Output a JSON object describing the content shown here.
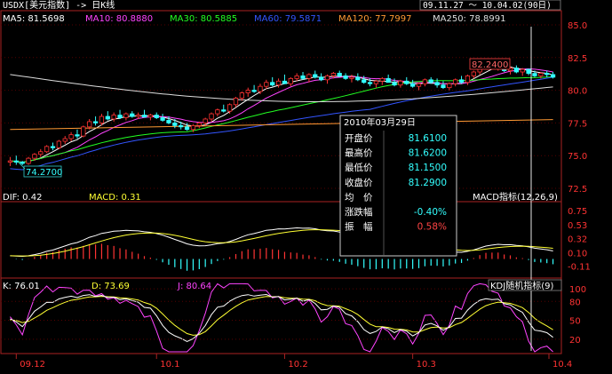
{
  "header": {
    "symbol": "USDX[美元指数] -> 日K线",
    "range": "09.11.27 ～ 10.04.02(90日)"
  },
  "ma_legend": [
    {
      "label": "MA5: 81.5698",
      "color": "#ffffff"
    },
    {
      "label": "MA10: 80.8880",
      "color": "#ff44ff"
    },
    {
      "label": "MA30: 80.5885",
      "color": "#22ff22"
    },
    {
      "label": "MA60: 79.5871",
      "color": "#3355ff"
    },
    {
      "label": "MA120: 77.7997",
      "color": "#ff9933"
    },
    {
      "label": "MA250: 78.8991",
      "color": "#dddddd"
    }
  ],
  "price_axis": [
    "85.0",
    "82.5",
    "80.0",
    "77.5",
    "75.0",
    "72.5"
  ],
  "price_high_label": "82.2400",
  "price_low_label": "74.2700",
  "macd_panel": {
    "dif_label": "DIF: 0.42",
    "macd_label": "MACD: 0.31",
    "name": "MACD指标(12,26,9)",
    "axis": [
      "0.75",
      "0.53",
      "0.32",
      "0.10",
      "-0.11"
    ]
  },
  "kdj_panel": {
    "k_label": "K: 76.01",
    "d_label": "D: 73.69",
    "j_label": "J: 80.64",
    "name": "KDJ随机指标(9)",
    "axis": [
      "100",
      "80",
      "50",
      "20"
    ]
  },
  "date_axis": [
    "09.12",
    "10.1",
    "10.2",
    "10.3",
    "10.4"
  ],
  "tooltip": {
    "date": "2010年03月29日",
    "rows": [
      {
        "label": "开盘价",
        "value": "81.6100"
      },
      {
        "label": "最高价",
        "value": "81.6200"
      },
      {
        "label": "最低价",
        "value": "81.1500"
      },
      {
        "label": "收盘价",
        "value": "81.2900"
      },
      {
        "label": "均　价",
        "value": ""
      },
      {
        "label": "涨跌幅",
        "value": "-0.40%"
      },
      {
        "label": "振　幅",
        "value": "0.58%"
      }
    ]
  },
  "colors": {
    "up": "#ff3333",
    "down": "#33ffff",
    "frame": "#aa2222",
    "axis_text": "#ff3333"
  },
  "chart_data": [
    {
      "type": "candlestick",
      "ylim": [
        72.5,
        85.0
      ],
      "candles": [
        [
          74.5,
          74.9,
          74.2,
          74.6
        ],
        [
          74.6,
          75.0,
          74.3,
          74.5
        ],
        [
          74.5,
          74.6,
          74.27,
          74.4
        ],
        [
          74.4,
          74.9,
          74.3,
          74.8
        ],
        [
          74.8,
          75.2,
          74.6,
          75.1
        ],
        [
          75.1,
          75.5,
          74.9,
          75.3
        ],
        [
          75.3,
          75.8,
          75.2,
          75.7
        ],
        [
          75.7,
          76.0,
          75.4,
          75.6
        ],
        [
          75.6,
          76.2,
          75.5,
          76.1
        ],
        [
          76.1,
          76.5,
          75.9,
          76.3
        ],
        [
          76.3,
          76.8,
          76.1,
          76.6
        ],
        [
          76.6,
          77.0,
          76.3,
          76.5
        ],
        [
          76.5,
          77.3,
          76.4,
          77.2
        ],
        [
          77.2,
          77.8,
          77.0,
          77.6
        ],
        [
          77.6,
          78.0,
          77.3,
          77.5
        ],
        [
          77.5,
          78.2,
          77.3,
          78.0
        ],
        [
          78.0,
          78.4,
          77.7,
          77.8
        ],
        [
          77.8,
          78.3,
          77.6,
          78.1
        ],
        [
          78.1,
          78.5,
          77.8,
          77.9
        ],
        [
          77.9,
          78.3,
          77.7,
          78.2
        ],
        [
          78.2,
          78.4,
          77.9,
          78.0
        ],
        [
          78.0,
          78.3,
          77.8,
          78.1
        ],
        [
          78.1,
          78.5,
          77.9,
          77.95
        ],
        [
          77.95,
          78.2,
          77.7,
          78.1
        ],
        [
          78.1,
          78.3,
          77.8,
          77.9
        ],
        [
          77.9,
          78.2,
          77.6,
          77.7
        ],
        [
          77.7,
          78.0,
          77.4,
          77.5
        ],
        [
          77.5,
          77.8,
          77.1,
          77.3
        ],
        [
          77.3,
          77.6,
          77.0,
          77.2
        ],
        [
          77.2,
          77.5,
          76.9,
          77.0
        ],
        [
          77.0,
          77.4,
          76.8,
          77.3
        ],
        [
          77.3,
          77.6,
          77.1,
          77.5
        ],
        [
          77.5,
          77.9,
          77.3,
          77.8
        ],
        [
          77.8,
          78.3,
          77.6,
          78.2
        ],
        [
          78.2,
          78.6,
          78.0,
          78.5
        ],
        [
          78.5,
          78.9,
          78.3,
          78.4
        ],
        [
          78.4,
          79.0,
          78.2,
          78.9
        ],
        [
          78.9,
          79.5,
          78.7,
          79.4
        ],
        [
          79.4,
          79.9,
          79.2,
          79.8
        ],
        [
          79.8,
          80.2,
          79.5,
          80.0
        ],
        [
          80.0,
          80.4,
          79.8,
          79.9
        ],
        [
          79.9,
          80.5,
          79.7,
          80.3
        ],
        [
          80.3,
          80.8,
          80.1,
          80.6
        ],
        [
          80.6,
          81.0,
          80.3,
          80.4
        ],
        [
          80.4,
          80.9,
          80.2,
          80.7
        ],
        [
          80.7,
          81.2,
          80.5,
          80.5
        ],
        [
          80.5,
          81.0,
          80.3,
          80.9
        ],
        [
          80.9,
          81.3,
          80.7,
          81.1
        ],
        [
          81.1,
          81.4,
          80.8,
          80.9
        ],
        [
          80.9,
          81.3,
          80.6,
          81.2
        ],
        [
          81.2,
          81.5,
          80.9,
          81.0
        ],
        [
          81.0,
          81.3,
          80.7,
          80.8
        ],
        [
          80.8,
          81.2,
          80.5,
          81.1
        ],
        [
          81.1,
          81.4,
          80.9,
          81.3
        ],
        [
          81.3,
          81.5,
          81.0,
          81.1
        ],
        [
          81.1,
          81.3,
          80.8,
          80.9
        ],
        [
          80.9,
          81.2,
          80.6,
          81.0
        ],
        [
          81.0,
          81.3,
          80.7,
          80.8
        ],
        [
          80.8,
          81.1,
          80.5,
          80.6
        ],
        [
          80.6,
          80.9,
          80.3,
          80.5
        ],
        [
          80.5,
          80.8,
          80.2,
          80.7
        ],
        [
          80.7,
          81.0,
          80.4,
          80.9
        ],
        [
          80.9,
          81.2,
          80.6,
          80.6
        ],
        [
          80.6,
          80.9,
          80.3,
          80.4
        ],
        [
          80.4,
          80.8,
          80.2,
          80.7
        ],
        [
          80.7,
          81.0,
          80.4,
          80.5
        ],
        [
          80.5,
          80.8,
          80.2,
          80.3
        ],
        [
          80.3,
          80.6,
          80.0,
          80.5
        ],
        [
          80.5,
          80.9,
          80.3,
          80.8
        ],
        [
          80.8,
          81.0,
          80.5,
          80.6
        ],
        [
          80.6,
          80.9,
          80.2,
          80.4
        ],
        [
          80.4,
          80.7,
          80.1,
          80.2
        ],
        [
          80.2,
          80.6,
          80.0,
          80.5
        ],
        [
          80.5,
          80.9,
          80.3,
          80.8
        ],
        [
          80.8,
          81.1,
          80.5,
          80.6
        ],
        [
          80.6,
          81.2,
          80.4,
          81.1
        ],
        [
          81.1,
          81.5,
          80.9,
          81.4
        ],
        [
          81.4,
          81.9,
          81.2,
          81.8
        ],
        [
          81.8,
          82.24,
          81.6,
          82.0
        ],
        [
          82.0,
          82.2,
          81.7,
          81.8
        ],
        [
          81.8,
          82.1,
          81.5,
          81.9
        ],
        [
          81.9,
          82.1,
          81.4,
          81.5
        ],
        [
          81.5,
          81.8,
          81.2,
          81.7
        ],
        [
          81.7,
          81.9,
          81.3,
          81.4
        ],
        [
          81.4,
          81.7,
          81.1,
          81.6
        ],
        [
          81.61,
          81.62,
          81.15,
          81.29
        ],
        [
          81.29,
          81.5,
          81.0,
          81.1
        ],
        [
          81.1,
          81.4,
          80.9,
          81.3
        ],
        [
          81.3,
          81.5,
          81.0,
          81.2
        ],
        [
          81.2,
          81.4,
          80.9,
          81.0
        ]
      ]
    },
    {
      "type": "bar",
      "name": "MACD",
      "ylim": [
        -0.2,
        0.85
      ]
    },
    {
      "type": "line",
      "name": "KDJ",
      "ylim": [
        0,
        110
      ]
    }
  ]
}
